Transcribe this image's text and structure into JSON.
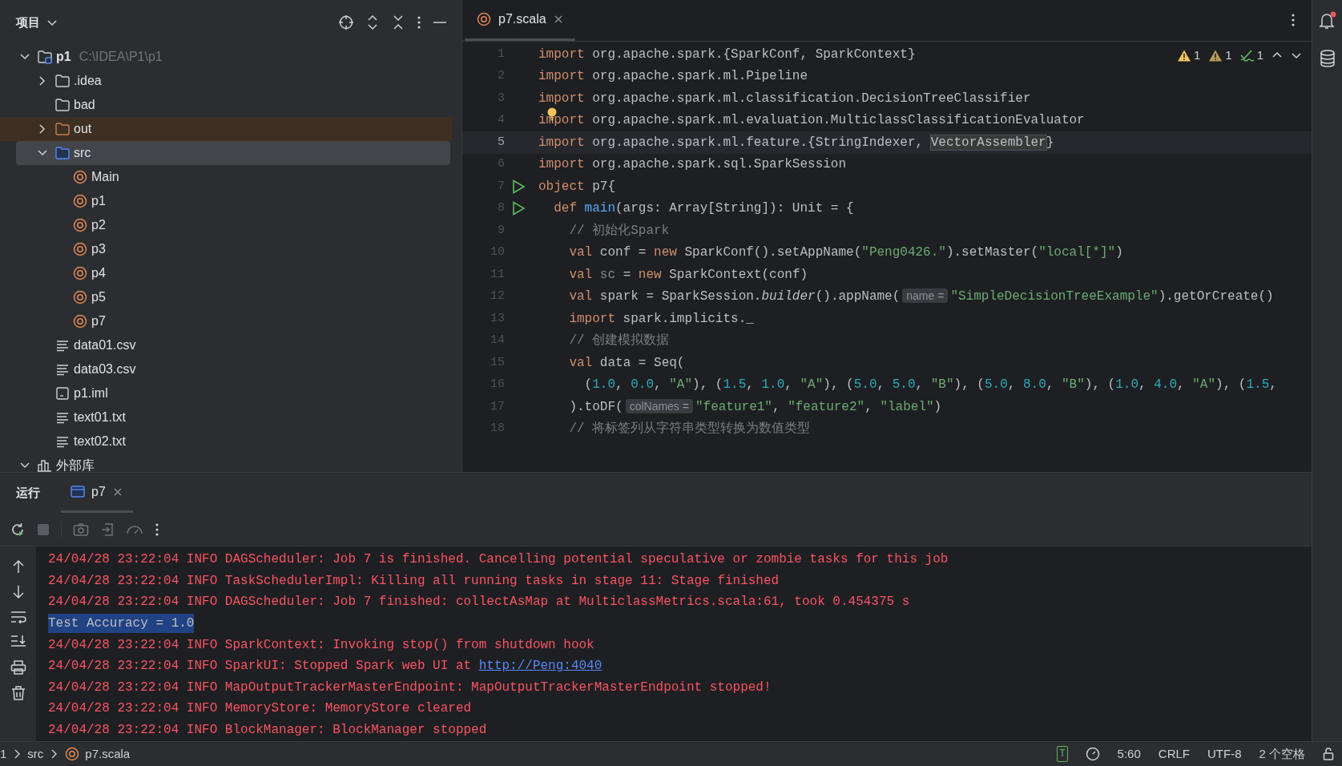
{
  "project_panel": {
    "title": "项目",
    "tree": [
      {
        "label": "p1",
        "path": "C:\\IDEA\\P1\\p1",
        "kind": "module",
        "expanded": true,
        "selected": false,
        "children": [
          {
            "label": ".idea",
            "kind": "folder",
            "expanded": false,
            "selected": false
          },
          {
            "label": "bad",
            "kind": "folder",
            "selected": false
          },
          {
            "label": "out",
            "kind": "excluded",
            "expanded": false,
            "selected": false
          },
          {
            "label": "src",
            "kind": "source",
            "expanded": true,
            "selected": true,
            "children": [
              {
                "label": "Main",
                "kind": "object",
                "selected": false
              },
              {
                "label": "p1",
                "kind": "object",
                "selected": false
              },
              {
                "label": "p2",
                "kind": "object",
                "selected": false
              },
              {
                "label": "p3",
                "kind": "object",
                "selected": false
              },
              {
                "label": "p4",
                "kind": "object",
                "selected": false
              },
              {
                "label": "p5",
                "kind": "object",
                "selected": false
              },
              {
                "label": "p7",
                "kind": "object",
                "selected": false
              }
            ]
          },
          {
            "label": "data01.csv",
            "kind": "text",
            "selected": false
          },
          {
            "label": "data03.csv",
            "kind": "text",
            "selected": false
          },
          {
            "label": "p1.iml",
            "kind": "iml",
            "selected": false
          },
          {
            "label": "text01.txt",
            "kind": "text",
            "selected": false
          },
          {
            "label": "text02.txt",
            "kind": "text",
            "selected": false
          }
        ]
      },
      {
        "label": "外部库",
        "kind": "library",
        "expanded": true,
        "selected": false
      }
    ]
  },
  "editor": {
    "tabs": [
      {
        "label": "p7.scala",
        "selected": true
      }
    ],
    "inspections": [
      {
        "kind": "warning",
        "count": "1"
      },
      {
        "kind": "weak-warning",
        "count": "1"
      },
      {
        "kind": "typo",
        "count": "1"
      }
    ],
    "lines": [
      {
        "n": "1",
        "current": false,
        "run": false,
        "bulb": false,
        "tokens": [
          {
            "text": "import",
            "kind": "kw"
          },
          {
            "text": " org.apache.spark.{SparkConf, SparkContext}",
            "kind": "plain"
          }
        ]
      },
      {
        "n": "2",
        "current": false,
        "run": false,
        "bulb": false,
        "tokens": [
          {
            "text": "import",
            "kind": "kw"
          },
          {
            "text": " org.apache.spark.ml.Pipeline",
            "kind": "plain"
          }
        ]
      },
      {
        "n": "3",
        "current": false,
        "run": false,
        "bulb": false,
        "tokens": [
          {
            "text": "import",
            "kind": "kw"
          },
          {
            "text": " org.apache.spark.ml.classification.DecisionTreeClassifier",
            "kind": "plain"
          }
        ]
      },
      {
        "n": "4",
        "current": false,
        "run": false,
        "bulb": true,
        "tokens": [
          {
            "text": "import",
            "kind": "kw"
          },
          {
            "text": " org.apache.spark.ml.evaluation.MulticlassClassificationEvaluator",
            "kind": "plain"
          }
        ]
      },
      {
        "n": "5",
        "current": true,
        "run": false,
        "bulb": false,
        "tokens": [
          {
            "text": "import",
            "kind": "kw"
          },
          {
            "text": " org.apache.spark.ml.feature.{StringIndexer, ",
            "kind": "plain"
          },
          {
            "text": "VectorAssembler",
            "kind": "mark"
          },
          {
            "text": "}",
            "kind": "plain"
          }
        ]
      },
      {
        "n": "6",
        "current": false,
        "run": false,
        "bulb": false,
        "tokens": [
          {
            "text": "import",
            "kind": "kw"
          },
          {
            "text": " org.apache.spark.sql.SparkSession",
            "kind": "plain"
          }
        ]
      },
      {
        "n": "7",
        "current": false,
        "run": true,
        "bulb": false,
        "tokens": [
          {
            "text": "object",
            "kind": "kw"
          },
          {
            "text": " p7{",
            "kind": "plain"
          }
        ]
      },
      {
        "n": "8",
        "current": false,
        "run": true,
        "bulb": false,
        "tokens": [
          {
            "text": "  def ",
            "kind": "kw"
          },
          {
            "text": "main",
            "kind": "fn"
          },
          {
            "text": "(args: Array[String]): Unit = {",
            "kind": "plain"
          }
        ]
      },
      {
        "n": "9",
        "current": false,
        "run": false,
        "bulb": false,
        "tokens": [
          {
            "text": "    // 初始化Spark",
            "kind": "comment"
          }
        ]
      },
      {
        "n": "10",
        "current": false,
        "run": false,
        "bulb": false,
        "tokens": [
          {
            "text": "    val",
            "kind": "kw"
          },
          {
            "text": " conf = ",
            "kind": "plain"
          },
          {
            "text": "new",
            "kind": "kw"
          },
          {
            "text": " SparkConf().setAppName(",
            "kind": "plain"
          },
          {
            "text": "\"Peng0426.\"",
            "kind": "str"
          },
          {
            "text": ").setMaster(",
            "kind": "plain"
          },
          {
            "text": "\"local[*]\"",
            "kind": "str"
          },
          {
            "text": ")",
            "kind": "plain"
          }
        ]
      },
      {
        "n": "11",
        "current": false,
        "run": false,
        "bulb": false,
        "tokens": [
          {
            "text": "    val",
            "kind": "kw"
          },
          {
            "text": " sc",
            "kind": "unused"
          },
          {
            "text": " = ",
            "kind": "plain"
          },
          {
            "text": "new",
            "kind": "kw"
          },
          {
            "text": " SparkContext(conf)",
            "kind": "plain"
          }
        ]
      },
      {
        "n": "12",
        "current": false,
        "run": false,
        "bulb": false,
        "tokens": [
          {
            "text": "    val",
            "kind": "kw"
          },
          {
            "text": " spark = SparkSession.",
            "kind": "plain"
          },
          {
            "text": "builder",
            "kind": "italic"
          },
          {
            "text": "().appName(",
            "kind": "plain"
          },
          {
            "text": "name =",
            "kind": "hint"
          },
          {
            "text": "\"SimpleDecisionTreeExample\"",
            "kind": "str"
          },
          {
            "text": ").getOrCreate()",
            "kind": "plain"
          }
        ]
      },
      {
        "n": "13",
        "current": false,
        "run": false,
        "bulb": false,
        "tokens": [
          {
            "text": "    import",
            "kind": "kw"
          },
          {
            "text": " spark.implicits._",
            "kind": "plain"
          }
        ]
      },
      {
        "n": "14",
        "current": false,
        "run": false,
        "bulb": false,
        "tokens": [
          {
            "text": "    // 创建模拟数据",
            "kind": "comment"
          }
        ]
      },
      {
        "n": "15",
        "current": false,
        "run": false,
        "bulb": false,
        "tokens": [
          {
            "text": "    val",
            "kind": "kw"
          },
          {
            "text": " data = Seq(",
            "kind": "plain"
          }
        ]
      },
      {
        "n": "16",
        "current": false,
        "run": false,
        "bulb": false,
        "tokens": [
          {
            "text": "      (",
            "kind": "plain"
          },
          {
            "text": "1.0",
            "kind": "num"
          },
          {
            "text": ", ",
            "kind": "plain"
          },
          {
            "text": "0.0",
            "kind": "num"
          },
          {
            "text": ", ",
            "kind": "plain"
          },
          {
            "text": "\"A\"",
            "kind": "str"
          },
          {
            "text": "), (",
            "kind": "plain"
          },
          {
            "text": "1.5",
            "kind": "num"
          },
          {
            "text": ", ",
            "kind": "plain"
          },
          {
            "text": "1.0",
            "kind": "num"
          },
          {
            "text": ", ",
            "kind": "plain"
          },
          {
            "text": "\"A\"",
            "kind": "str"
          },
          {
            "text": "), (",
            "kind": "plain"
          },
          {
            "text": "5.0",
            "kind": "num"
          },
          {
            "text": ", ",
            "kind": "plain"
          },
          {
            "text": "5.0",
            "kind": "num"
          },
          {
            "text": ", ",
            "kind": "plain"
          },
          {
            "text": "\"B\"",
            "kind": "str"
          },
          {
            "text": "), (",
            "kind": "plain"
          },
          {
            "text": "5.0",
            "kind": "num"
          },
          {
            "text": ", ",
            "kind": "plain"
          },
          {
            "text": "8.0",
            "kind": "num"
          },
          {
            "text": ", ",
            "kind": "plain"
          },
          {
            "text": "\"B\"",
            "kind": "str"
          },
          {
            "text": "), (",
            "kind": "plain"
          },
          {
            "text": "1.0",
            "kind": "num"
          },
          {
            "text": ", ",
            "kind": "plain"
          },
          {
            "text": "4.0",
            "kind": "num"
          },
          {
            "text": ", ",
            "kind": "plain"
          },
          {
            "text": "\"A\"",
            "kind": "str"
          },
          {
            "text": "), (",
            "kind": "plain"
          },
          {
            "text": "1.5",
            "kind": "num"
          },
          {
            "text": ",",
            "kind": "plain"
          }
        ]
      },
      {
        "n": "17",
        "current": false,
        "run": false,
        "bulb": false,
        "tokens": [
          {
            "text": "    ).toDF(",
            "kind": "plain"
          },
          {
            "text": "colNames =",
            "kind": "hint"
          },
          {
            "text": "\"feature1\"",
            "kind": "str"
          },
          {
            "text": ", ",
            "kind": "plain"
          },
          {
            "text": "\"feature2\"",
            "kind": "str"
          },
          {
            "text": ", ",
            "kind": "plain"
          },
          {
            "text": "\"label\"",
            "kind": "str"
          },
          {
            "text": ")",
            "kind": "plain"
          }
        ]
      },
      {
        "n": "18",
        "current": false,
        "run": false,
        "bulb": false,
        "tokens": [
          {
            "text": "    // 将标签列从字符串类型转换为数值类型",
            "kind": "comment"
          }
        ]
      }
    ]
  },
  "run_panel": {
    "title": "运行",
    "tabs": [
      {
        "label": "p7",
        "selected": true
      }
    ],
    "console": [
      {
        "kind": "stderr",
        "tokens": [
          {
            "text": "24/04/28 23:22:04 INFO DAGScheduler: Job 7 is finished. Cancelling potential speculative or zombie tasks for this job",
            "kind": "plain"
          }
        ]
      },
      {
        "kind": "stderr",
        "tokens": [
          {
            "text": "24/04/28 23:22:04 INFO TaskSchedulerImpl: Killing all running tasks in stage 11: Stage finished",
            "kind": "plain"
          }
        ]
      },
      {
        "kind": "stderr",
        "tokens": [
          {
            "text": "24/04/28 23:22:04 INFO DAGScheduler: Job 7 finished: collectAsMap at MulticlassMetrics.scala:61, took 0.454375 s",
            "kind": "plain"
          }
        ]
      },
      {
        "kind": "stdout-selected",
        "tokens": [
          {
            "text": "Test Accuracy = 1.0",
            "kind": "plain"
          }
        ]
      },
      {
        "kind": "stderr",
        "tokens": [
          {
            "text": "24/04/28 23:22:04 INFO SparkContext: Invoking stop() from shutdown hook",
            "kind": "plain"
          }
        ]
      },
      {
        "kind": "stderr",
        "tokens": [
          {
            "text": "24/04/28 23:22:04 INFO SparkUI: Stopped Spark web UI at ",
            "kind": "plain"
          },
          {
            "text": "http://Peng:4040",
            "kind": "link"
          }
        ]
      },
      {
        "kind": "stderr",
        "tokens": [
          {
            "text": "24/04/28 23:22:04 INFO MapOutputTrackerMasterEndpoint: MapOutputTrackerMasterEndpoint stopped!",
            "kind": "plain"
          }
        ]
      },
      {
        "kind": "stderr",
        "tokens": [
          {
            "text": "24/04/28 23:22:04 INFO MemoryStore: MemoryStore cleared",
            "kind": "plain"
          }
        ]
      },
      {
        "kind": "stderr",
        "tokens": [
          {
            "text": "24/04/28 23:22:04 INFO BlockManager: BlockManager stopped",
            "kind": "plain"
          }
        ]
      }
    ]
  },
  "status_bar": {
    "breadcrumbs": [
      "1",
      "src",
      "p7.scala"
    ],
    "text_mode": "T",
    "position": "5:60",
    "line_separator": "CRLF",
    "encoding": "UTF-8",
    "indent": "2 个空格"
  }
}
